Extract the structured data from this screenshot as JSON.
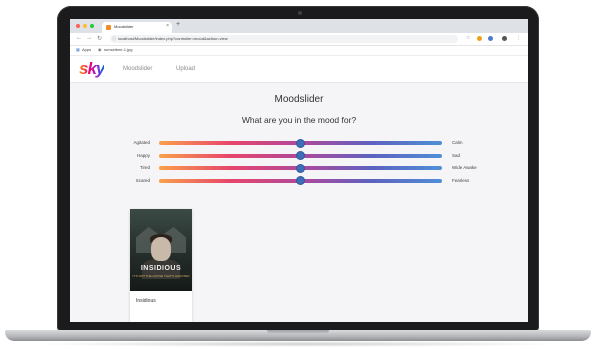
{
  "browser": {
    "tab_title": "Moodslider",
    "tab_close": "×",
    "new_tab": "+",
    "nav": {
      "back": "←",
      "forward": "→",
      "reload": "↻"
    },
    "url": "localhost/Moodslider/index.php?controller=mood&action=view",
    "lock": "ⓘ",
    "bookmarks": [
      {
        "icon": "apps-icon",
        "label": "Apps"
      },
      {
        "icon": "globe-icon",
        "label": "sunsetbee-1.jpg"
      }
    ]
  },
  "app": {
    "logo": "sky",
    "nav": [
      "Moodslider",
      "Upload"
    ]
  },
  "main": {
    "title": "Moodslider",
    "subtitle": "What are you in the mood for?",
    "sliders": [
      {
        "left": "Agitated",
        "right": "Calm",
        "value": 0.5
      },
      {
        "left": "Happy",
        "right": "Sad",
        "value": 0.5
      },
      {
        "left": "Tired",
        "right": "Wide Awake",
        "value": 0.5
      },
      {
        "left": "Scared",
        "right": "Fearless",
        "value": 0.5
      }
    ],
    "movies": [
      {
        "title": "Insidious",
        "poster_text": "INSIDIOUS",
        "poster_tag": "IT'S NOT THE HOUSE THAT'S HAUNTED"
      }
    ]
  },
  "colors": {
    "slider_gradient": [
      "#f9a04b",
      "#e8456b",
      "#b0489a",
      "#5d62c0",
      "#4f8fd6"
    ],
    "thumb": "#3d6fb8"
  }
}
